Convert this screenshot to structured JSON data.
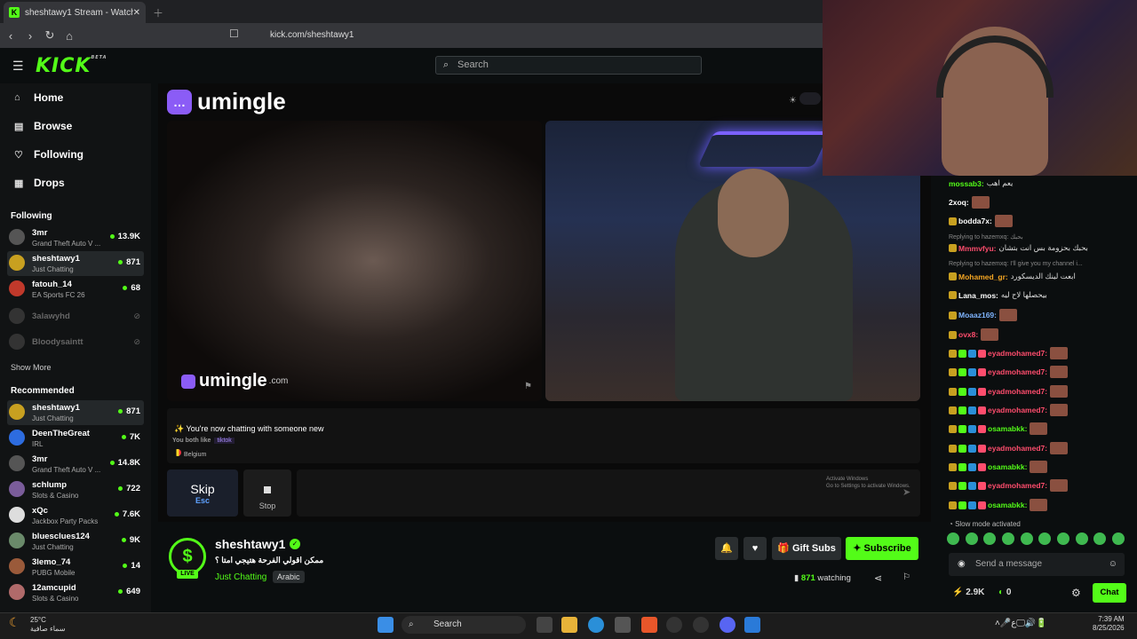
{
  "browser": {
    "tab_title": "sheshtawy1 Stream - Watch L",
    "url": "kick.com/sheshtawy1"
  },
  "header": {
    "logo": "KICK",
    "logo_badge": "BETA",
    "search_placeholder": "Search"
  },
  "sidebar": {
    "nav": [
      {
        "label": "Home",
        "icon": "home-icon"
      },
      {
        "label": "Browse",
        "icon": "browse-icon"
      },
      {
        "label": "Following",
        "icon": "heart-icon"
      },
      {
        "label": "Drops",
        "icon": "drops-icon"
      }
    ],
    "following_title": "Following",
    "following": [
      {
        "name": "3mr",
        "category": "Grand Theft Auto V ...",
        "viewers": "13.9K"
      },
      {
        "name": "sheshtawy1",
        "category": "Just Chatting",
        "viewers": "871"
      },
      {
        "name": "fatouh_14",
        "category": "EA Sports FC 26",
        "viewers": "68"
      },
      {
        "name": "3alawyhd",
        "category": "",
        "viewers": ""
      },
      {
        "name": "Bloodysaintt",
        "category": "",
        "viewers": ""
      }
    ],
    "show_more": "Show More",
    "recommended_title": "Recommended",
    "recommended": [
      {
        "name": "sheshtawy1",
        "category": "Just Chatting",
        "viewers": "871"
      },
      {
        "name": "DeenTheGreat",
        "category": "IRL",
        "viewers": "7K"
      },
      {
        "name": "3mr",
        "category": "Grand Theft Auto V ...",
        "viewers": "14.8K"
      },
      {
        "name": "schlump",
        "category": "Slots & Casino",
        "viewers": "722"
      },
      {
        "name": "xQc",
        "category": "Jackbox Party Packs",
        "viewers": "7.6K"
      },
      {
        "name": "bluesclues124",
        "category": "Just Chatting",
        "viewers": "9K"
      },
      {
        "name": "3lemo_74",
        "category": "PUBG Mobile",
        "viewers": "14"
      },
      {
        "name": "12amcupid",
        "category": "Slots & Casino",
        "viewers": "649"
      }
    ]
  },
  "stream_overlay": {
    "brand": "umingle",
    "brand_small": "umingle",
    "brand_domain": ".com",
    "status": "✨ You're now chatting with someone new",
    "both_like_label": "You both like",
    "both_like_tag": "tiktok",
    "country": "Belgium",
    "skip_label": "Skip",
    "skip_key": "Esc",
    "stop_label": "Stop",
    "activate_windows": "Activate Windows",
    "activate_windows_sub": "Go to Settings to activate Windows."
  },
  "stream_info": {
    "channel": "sheshtawy1",
    "title": "ممكن اقولي الفرحة هتيجي امتا ؟",
    "category": "Just Chatting",
    "language": "Arabic",
    "live": "LIVE",
    "gift_subs": "Gift Subs",
    "subscribe": "Subscribe",
    "viewers": "871",
    "watching": "watching"
  },
  "chat": {
    "messages": [
      {
        "user": "mossab3:",
        "text": "يعم اهب",
        "color": "#53fc18"
      },
      {
        "user": "2xoq:",
        "text": "",
        "color": "#ffffff"
      },
      {
        "user": "bodda7x:",
        "text": "",
        "color": "#ffffff"
      },
      {
        "reply": "Replying to hazemxq: بحبك"
      },
      {
        "user": "Mmmvfyu:",
        "text": "بحبك بحزومة بس انت بتشان",
        "color": "#ff4d6d"
      },
      {
        "reply": "Replying to hazemxq: I'll give you my channel i..."
      },
      {
        "user": "Mohamed_gr:",
        "text": "ابعت لينك الديسكورد",
        "color": "#f5a623"
      },
      {
        "user": "Lana_mos:",
        "text": "بيحصلها لاح ليه",
        "color": "#ffffff"
      },
      {
        "user": "Moaaz169:",
        "text": "",
        "color": "#7fb4ff"
      },
      {
        "user": "ovx8:",
        "text": "",
        "color": "#ff4d6d"
      },
      {
        "user": "eyadmohamed7:",
        "text": "",
        "color": "#ff4d6d"
      },
      {
        "user": "eyadmohamed7:",
        "text": "",
        "color": "#ff4d6d"
      },
      {
        "user": "eyadmohamed7:",
        "text": "",
        "color": "#ff4d6d"
      },
      {
        "user": "eyadmohamed7:",
        "text": "",
        "color": "#ff4d6d"
      },
      {
        "user": "osamabkk:",
        "text": "",
        "color": "#53fc18"
      },
      {
        "user": "eyadmohamed7:",
        "text": "",
        "color": "#ff4d6d"
      },
      {
        "user": "osamabkk:",
        "text": "",
        "color": "#53fc18"
      },
      {
        "user": "eyadmohamed7:",
        "text": "",
        "color": "#ff4d6d"
      },
      {
        "user": "osamabkk:",
        "text": "",
        "color": "#53fc18"
      }
    ],
    "slow_mode": "Slow mode activated",
    "send_placeholder": "Send a message",
    "points": "2.9K",
    "points2": "0",
    "chat_button": "Chat"
  },
  "taskbar": {
    "temp": "25°C",
    "weather": "سماء صافية",
    "search": "Search",
    "time": "7:39 AM",
    "date": "8/25/2026"
  },
  "colors": {
    "brand": "#53fc18",
    "background": "#0b0e0f"
  }
}
